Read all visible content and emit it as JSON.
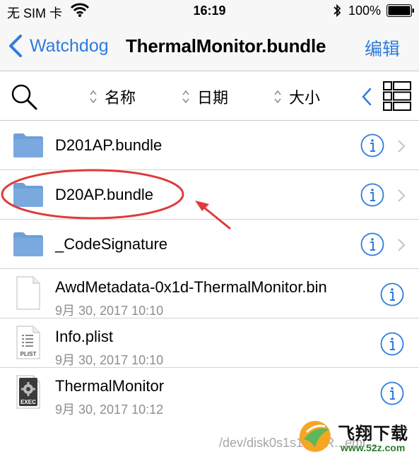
{
  "status_bar": {
    "carrier": "无 SIM 卡",
    "time": "16:19",
    "battery_percent": "100%",
    "icons": [
      "wifi-icon",
      "bluetooth-icon",
      "battery-icon"
    ]
  },
  "nav": {
    "back_label": "Watchdog",
    "title": "ThermalMonitor.bundle",
    "edit_label": "编辑"
  },
  "toolbar": {
    "sort_name": "名称",
    "sort_date": "日期",
    "sort_size": "大小"
  },
  "files": [
    {
      "name": "D201AP.bundle",
      "type": "folder"
    },
    {
      "name": "D20AP.bundle",
      "type": "folder",
      "highlighted": true
    },
    {
      "name": "_CodeSignature",
      "type": "folder"
    },
    {
      "name": "AwdMetadata-0x1d-ThermalMonitor.bin",
      "type": "file",
      "date": "9月 30, 2017 10:10"
    },
    {
      "name": "Info.plist",
      "type": "plist",
      "icon_label": "PLIST",
      "date": "9月 30, 2017 10:10"
    },
    {
      "name": "ThermalMonitor",
      "type": "exec",
      "icon_label": "EXEC",
      "date": "9月 30, 2017 10:12"
    }
  ],
  "footer_path": "/dev/disk0s1s1 (... R...emi...",
  "watermark": {
    "name": "飞翔下载",
    "url": "www.52z.com"
  },
  "colors": {
    "accent": "#2f7bdc",
    "folder": "#6f9fd8",
    "annotation": "#e03a3a",
    "separator": "#d4d4d8"
  }
}
